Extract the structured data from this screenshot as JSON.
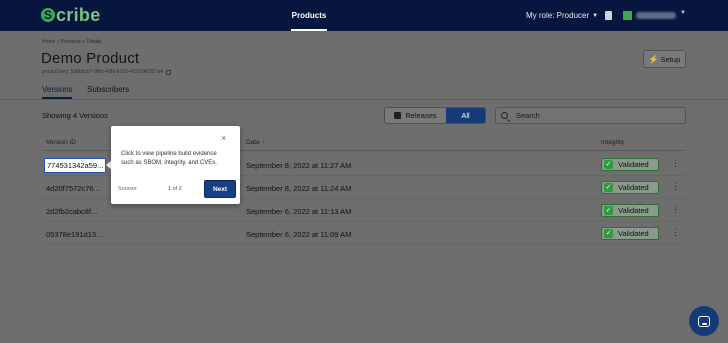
{
  "app": {
    "logo_letter": "S",
    "logo_text": "cribe"
  },
  "topnav": {
    "products_label": "Products",
    "role_label": "My role: Producer"
  },
  "breadcrumb": "Home > Products > Details",
  "product": {
    "title": "Demo Product",
    "key_label": "product key: 5a6bbcb7-8f9c-42fb-b192-4922940397a4"
  },
  "setup_label": "Setup",
  "tabs": [
    {
      "label": "Versions",
      "active": true
    },
    {
      "label": "Subscribers",
      "active": false
    }
  ],
  "showing_label": "Showing 4 Versions",
  "filter": {
    "releases_label": "Releases",
    "all_label": "All"
  },
  "search": {
    "placeholder": "Search"
  },
  "table": {
    "headers": {
      "version": "Version ID",
      "date": "Date",
      "date_sort": "↑",
      "integrity": "Integrity"
    },
    "rows": [
      {
        "version": "774531342a59...",
        "date": "September 8, 2022 at 11:27 AM",
        "status": "Validated"
      },
      {
        "version": "4d20f7572c76...",
        "date": "September 8, 2022 at 11:24 AM",
        "status": "Validated"
      },
      {
        "version": "2d2fb2cabc8f...",
        "date": "September 6, 2022 at 11:13 AM",
        "status": "Validated"
      },
      {
        "version": "05378e191d13...",
        "date": "September 6, 2022 at 11:09 AM",
        "status": "Validated"
      }
    ]
  },
  "popover": {
    "close": "×",
    "text": "Click to view pipeline build evidence such as SBOM, integrity, and CVEs.",
    "snooze": "Snooze",
    "count": "1 of 2",
    "next": "Next"
  },
  "icons": {
    "check": "✓",
    "kebab": "⋮",
    "bolt": "⚡",
    "chevron": "▼"
  },
  "colors": {
    "nav_bg": "#06163f",
    "accent": "#143a78",
    "validated": "#2e9a3e"
  }
}
